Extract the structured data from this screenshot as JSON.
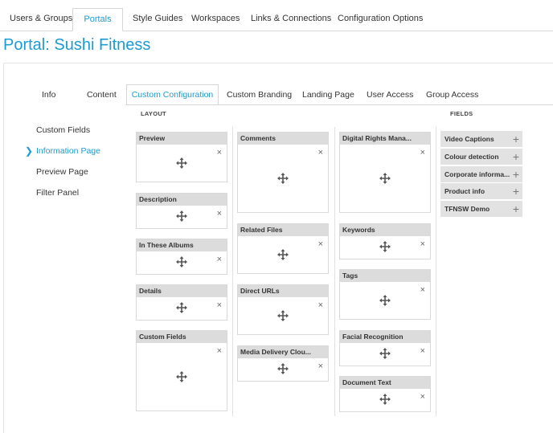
{
  "top_tabs": [
    {
      "label": "Users & Groups"
    },
    {
      "label": "Portals"
    },
    {
      "label": "Style Guides"
    },
    {
      "label": "Workspaces"
    },
    {
      "label": "Links & Connections"
    },
    {
      "label": "Configuration Options"
    }
  ],
  "page": {
    "title": "Portal: Sushi Fitness"
  },
  "sub_tabs": [
    {
      "label": "Info"
    },
    {
      "label": "Content"
    },
    {
      "label": "Custom Configuration"
    },
    {
      "label": "Custom Branding"
    },
    {
      "label": "Landing Page"
    },
    {
      "label": "User Access"
    },
    {
      "label": "Group Access"
    }
  ],
  "side_nav": [
    {
      "label": "Custom Fields"
    },
    {
      "label": "Information Page"
    },
    {
      "label": "Preview Page"
    },
    {
      "label": "Filter Panel"
    }
  ],
  "layout": {
    "label": "LAYOUT"
  },
  "fields_panel": {
    "label": "FIELDS"
  },
  "columns": [
    [
      {
        "title": "Preview"
      },
      {
        "title": "Description"
      },
      {
        "title": "In These Albums"
      },
      {
        "title": "Details"
      },
      {
        "title": "Custom Fields"
      }
    ],
    [
      {
        "title": "Comments"
      },
      {
        "title": "Related Files"
      },
      {
        "title": "Direct URLs"
      },
      {
        "title": "Media Delivery Clou..."
      }
    ],
    [
      {
        "title": "Digital Rights Mana..."
      },
      {
        "title": "Keywords"
      },
      {
        "title": "Tags"
      },
      {
        "title": "Facial Recognition"
      },
      {
        "title": "Document Text"
      }
    ]
  ],
  "fields": [
    {
      "label": "Video Captions"
    },
    {
      "label": "Colour detection"
    },
    {
      "label": "Corporate informa..."
    },
    {
      "label": "Product info"
    },
    {
      "label": "TFNSW Demo"
    }
  ],
  "icons": {
    "remove": "×",
    "add": "+"
  }
}
